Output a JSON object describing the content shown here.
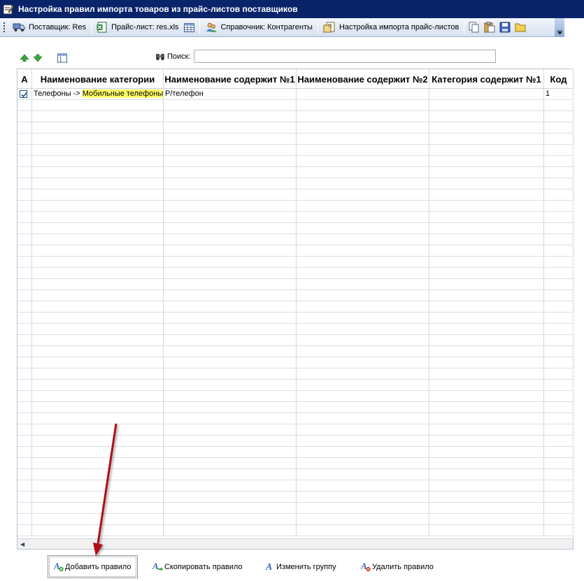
{
  "window": {
    "title": "Настройка правил импорта товаров из прайс-листов поставщиков"
  },
  "toolbar": {
    "supplier_label": "Поставщик: Res",
    "pricelist_label": "Прайс-лист: res.xls",
    "directory_label": "Справочник: Контрагенты",
    "import_settings_label": "Настройка импорта прайс-листов"
  },
  "filter": {
    "search_label": "Поиск:",
    "search_value": ""
  },
  "grid": {
    "columns": [
      "А",
      "Наименование категории",
      "Наименование содержит №1",
      "Наименование содержит №2",
      "Категория содержит №1",
      "Код"
    ],
    "rows": [
      {
        "checked": true,
        "category_prefix": "Телефоны -> ",
        "category_highlight": "Мобильные телефоны",
        "contains1": "Р/телефон",
        "contains2": "",
        "category_contains1": "",
        "code": "1"
      }
    ]
  },
  "actions": {
    "add_rule": "Добавить правило",
    "copy_rule": "Скопировать правило",
    "change_group": "Изменить группу",
    "delete_rule": "Удалить правило"
  },
  "icons": {
    "title": "pencil-icon",
    "supplier": "truck-icon",
    "pricelist": "excel-icon",
    "pricelist_table": "table-icon",
    "directory": "people-icon",
    "import_settings": "settings-doc-icon",
    "copy": "copy-icon",
    "paste": "paste-icon",
    "save": "save-icon",
    "open": "folder-icon",
    "move_up": "arrow-up-icon",
    "move_down": "arrow-down-icon",
    "columns": "columns-icon",
    "search": "binoculars-icon"
  },
  "colors": {
    "titlebar": "#0a246a",
    "highlight": "#ffff66",
    "annotation_arrow": "#b01018"
  }
}
